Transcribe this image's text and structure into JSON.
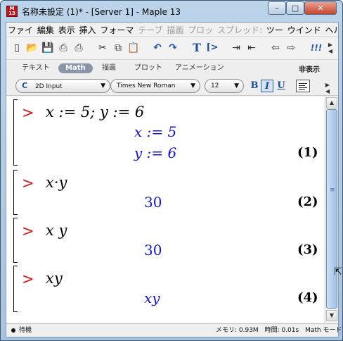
{
  "window": {
    "title": "名称未設定 (1)* - [Server 1] - Maple 13",
    "icon_text": "M\n13",
    "controls": {
      "minimize": "–",
      "maximize": "□",
      "close": "✕"
    }
  },
  "menubar": {
    "items": [
      {
        "label": "ファイ",
        "enabled": true
      },
      {
        "label": "編集",
        "enabled": true
      },
      {
        "label": "表示",
        "enabled": true
      },
      {
        "label": "挿入",
        "enabled": true
      },
      {
        "label": "フォーマ",
        "enabled": true
      },
      {
        "label": "テーブ",
        "enabled": false
      },
      {
        "label": "描画",
        "enabled": false
      },
      {
        "label": "プロッ",
        "enabled": false
      },
      {
        "label": "スプレッド:",
        "enabled": false
      },
      {
        "label": "ツー",
        "enabled": true
      },
      {
        "label": "ウインド",
        "enabled": true
      },
      {
        "label": "ヘルフ",
        "enabled": true
      }
    ]
  },
  "toolbar": {
    "buttons": [
      {
        "name": "new-document-icon",
        "glyph": "▯"
      },
      {
        "name": "open-folder-icon",
        "glyph": "📂"
      },
      {
        "name": "save-icon",
        "glyph": "💾"
      },
      {
        "name": "print-icon",
        "glyph": "⎙"
      },
      {
        "name": "print-preview-icon",
        "glyph": "⎙"
      },
      {
        "name": "cut-icon",
        "glyph": "✂"
      },
      {
        "name": "copy-icon",
        "glyph": "⧉"
      },
      {
        "name": "paste-icon",
        "glyph": "📋"
      },
      {
        "name": "undo-icon",
        "glyph": "↶"
      },
      {
        "name": "redo-icon",
        "glyph": "↷"
      },
      {
        "name": "text-mode-icon",
        "glyph": "T"
      },
      {
        "name": "math-prompt-icon",
        "glyph": "[>"
      },
      {
        "name": "indent-icon",
        "glyph": "⇥"
      },
      {
        "name": "outdent-icon",
        "glyph": "⇤"
      },
      {
        "name": "back-icon",
        "glyph": "⇦"
      },
      {
        "name": "forward-icon",
        "glyph": "⇨"
      },
      {
        "name": "execute-all-icon",
        "glyph": "!!!"
      }
    ]
  },
  "context_bar": {
    "tabs": [
      {
        "label": "テキスト",
        "active": false
      },
      {
        "label": "Math",
        "active": true
      },
      {
        "label": "描画",
        "active": false
      },
      {
        "label": "プロット",
        "active": false
      },
      {
        "label": "アニメーション",
        "active": false
      }
    ],
    "hide_label": "非表示",
    "input_mode": "2D Input",
    "input_mode_prefix": "C",
    "font": "Times New Roman",
    "font_size": "12",
    "bold": "B",
    "italic": "I",
    "underline": "U"
  },
  "worksheet": {
    "groups": [
      {
        "prompt": ">",
        "input": "x := 5; y := 6",
        "outputs": [
          "x := 5",
          "y := 6"
        ],
        "label": "(1)"
      },
      {
        "prompt": ">",
        "input": "x·y",
        "outputs": [
          "30"
        ],
        "label": "(2)"
      },
      {
        "prompt": ">",
        "input": "x y",
        "outputs": [
          "30"
        ],
        "label": "(3)"
      },
      {
        "prompt": ">",
        "input": "xy",
        "outputs": [
          "xy"
        ],
        "label": "(4)"
      }
    ]
  },
  "statusbar": {
    "state": "待機",
    "memory": "メモリ: 0.93M",
    "time": "時間: 0.01s",
    "mode": "Math モード"
  },
  "colors": {
    "prompt": "#d41b1b",
    "output": "#1414d2",
    "input": "#000000"
  }
}
